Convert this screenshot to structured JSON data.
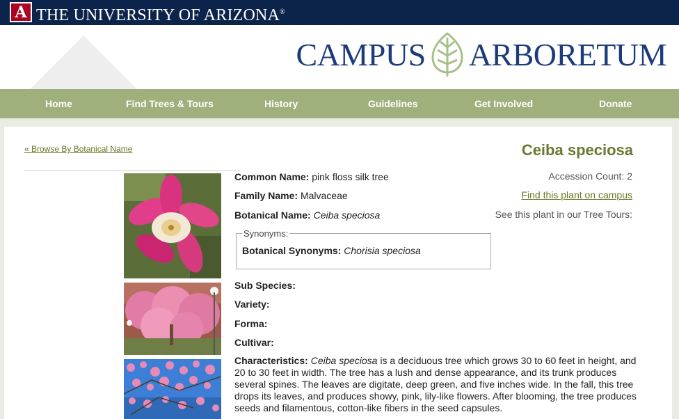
{
  "university": {
    "name": "The University of Arizona",
    "logo_letter": "A",
    "trademark": "®"
  },
  "brand": {
    "word1": "Campus",
    "word2": "Arboretum"
  },
  "nav": [
    {
      "label": "Home"
    },
    {
      "label": "Find Trees & Tours"
    },
    {
      "label": "History"
    },
    {
      "label": "Guidelines"
    },
    {
      "label": "Get Involved"
    },
    {
      "label": "Donate"
    }
  ],
  "breadcrumb": "« Browse By Botanical Name",
  "title": "Ceiba speciosa",
  "fields": {
    "common_name_label": "Common Name:",
    "common_name": "pink floss silk tree",
    "family_name_label": "Family Name:",
    "family_name": "Malvaceae",
    "botanical_name_label": "Botanical Name:",
    "botanical_name": "Ceiba speciosa",
    "synonyms_legend": "Synonyms:",
    "botanical_synonyms_label": "Botanical Synonyms:",
    "botanical_synonyms": "Chorisia speciosa",
    "sub_species_label": "Sub Species:",
    "variety_label": "Variety:",
    "forma_label": "Forma:",
    "cultivar_label": "Cultivar:",
    "characteristics_label": "Characteristics:",
    "characteristics_italic": "Ceiba speciosa",
    "characteristics_text": " is a deciduous tree which grows 30 to 60 feet in height, and 20 to 30 feet in width. The tree has a lush and dense appearance, and its trunk produces several spines. The leaves are digitate, deep green, and five inches wide. In the fall, this tree drops its leaves, and produces showy, pink, lily-like flowers. After blooming, the tree produces seeds and filamentous, cotton-like fibers in the seed capsules."
  },
  "side": {
    "accession_count": "Accession Count: 2",
    "find_link": "Find this plant on campus",
    "tours_text": "See this plant in our Tree Tours:"
  },
  "photos": [
    {
      "icon": "pink-flower-closeup"
    },
    {
      "icon": "flowering-tree"
    },
    {
      "icon": "pink-blossoms-sky"
    }
  ],
  "colors": {
    "ua_navy": "#0c234b",
    "ua_red": "#ab0520",
    "nav_green": "#9fb07c",
    "title_olive": "#6a7a32",
    "brand_blue": "#1c3b7a"
  }
}
